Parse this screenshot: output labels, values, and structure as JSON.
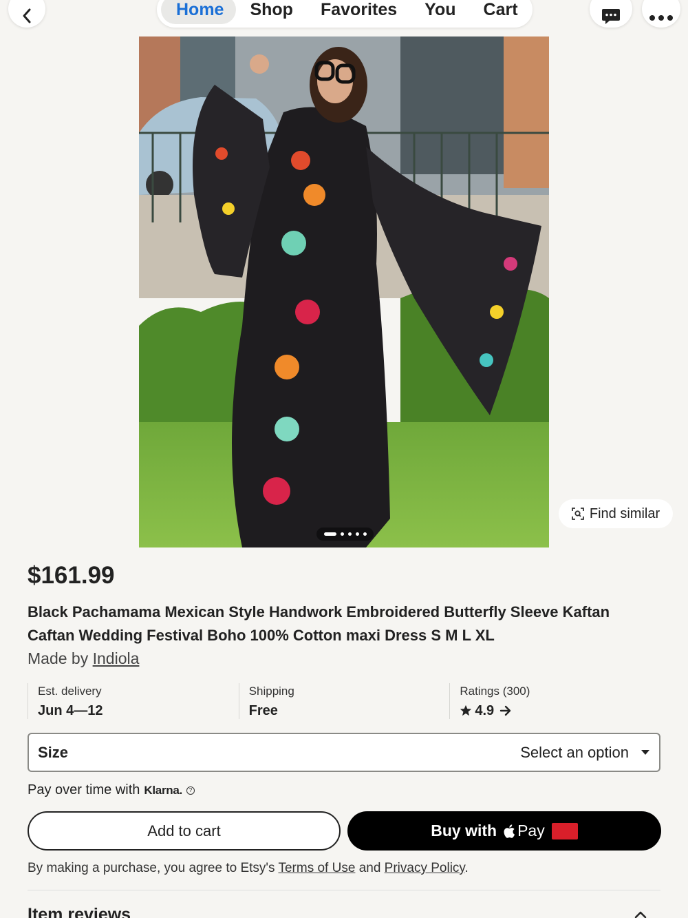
{
  "nav": {
    "tabs": [
      {
        "label": "Home",
        "active": true
      },
      {
        "label": "Shop"
      },
      {
        "label": "Favorites"
      },
      {
        "label": "You"
      },
      {
        "label": "Cart"
      }
    ],
    "accent_color": "#1a6fd6"
  },
  "gallery": {
    "image_count": 5,
    "current_index": 0,
    "find_similar_label": "Find similar"
  },
  "product": {
    "price": "$161.99",
    "title": "Black Pachamama Mexican Style Handwork Embroidered Butterfly Sleeve Kaftan Caftan Wedding Festival Boho 100% Cotton maxi Dress S M L XL",
    "made_by_prefix": "Made by",
    "shop_name": "Indiola"
  },
  "info": {
    "delivery_label": "Est. delivery",
    "delivery_value": "Jun 4—12",
    "shipping_label": "Shipping",
    "shipping_value": "Free",
    "ratings_label": "Ratings (300)",
    "ratings_value": "4.9"
  },
  "size": {
    "label": "Size",
    "placeholder": "Select an option"
  },
  "klarna": {
    "text": "Pay over time with",
    "brand": "Klarna."
  },
  "actions": {
    "add_to_cart": "Add to cart",
    "buy_with": "Buy with",
    "pay_brand": "Pay"
  },
  "legal": {
    "prefix": "By making a purchase, you agree to Etsy's",
    "terms": "Terms of Use",
    "and": "and",
    "privacy": "Privacy Policy",
    "suffix": "."
  },
  "reviews": {
    "heading": "Item reviews"
  }
}
